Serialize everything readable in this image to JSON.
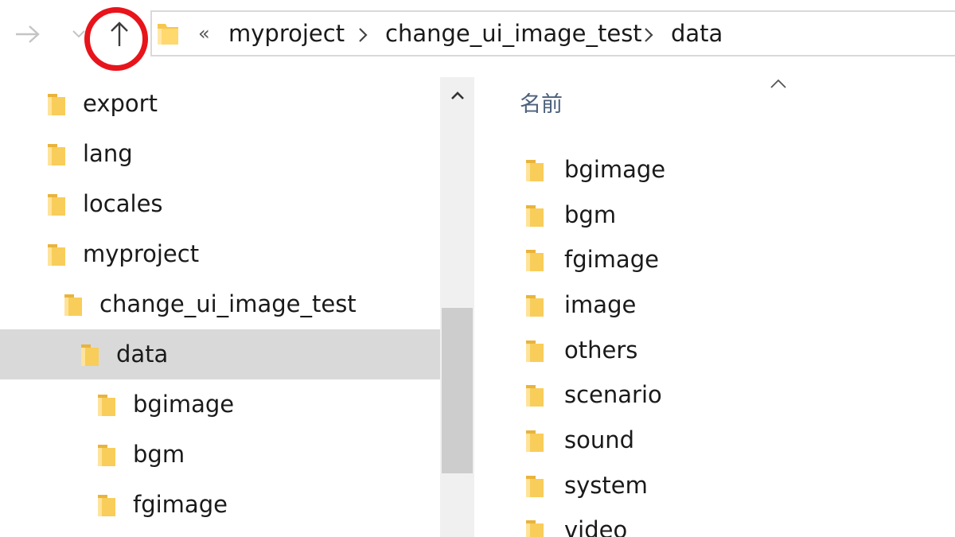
{
  "toolbar": {
    "forward_icon": "arrow-right-icon",
    "recent_icon": "chevron-down-icon",
    "up_icon": "arrow-up-icon",
    "highlight_color": "#e8141b"
  },
  "address_bar": {
    "overflow_glyph": "«",
    "breadcrumbs": [
      "myproject",
      "change_ui_image_test",
      "data"
    ]
  },
  "nav_tree": {
    "items": [
      {
        "label": "export",
        "depth": 0,
        "selected": false
      },
      {
        "label": "lang",
        "depth": 0,
        "selected": false
      },
      {
        "label": "locales",
        "depth": 0,
        "selected": false
      },
      {
        "label": "myproject",
        "depth": 0,
        "selected": false
      },
      {
        "label": "change_ui_image_test",
        "depth": 1,
        "selected": false
      },
      {
        "label": "data",
        "depth": 2,
        "selected": true
      },
      {
        "label": "bgimage",
        "depth": 3,
        "selected": false
      },
      {
        "label": "bgm",
        "depth": 3,
        "selected": false
      },
      {
        "label": "fgimage",
        "depth": 3,
        "selected": false
      }
    ]
  },
  "content": {
    "column_header": "名前",
    "items": [
      "bgimage",
      "bgm",
      "fgimage",
      "image",
      "others",
      "scenario",
      "sound",
      "system",
      "video"
    ]
  },
  "colors": {
    "folder_fill": "#f6c750",
    "folder_light": "#ffe39a",
    "selected_bg": "#d9d9d9",
    "header_text": "#4c607a"
  }
}
